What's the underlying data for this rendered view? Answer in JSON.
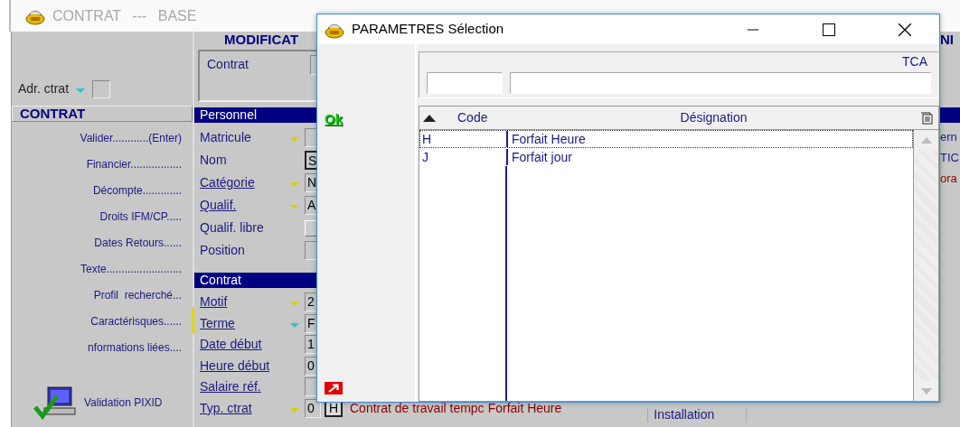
{
  "app_window": {
    "title": "CONTRAT --- BASE"
  },
  "sidebar": {
    "address": {
      "label": "Adr. ctrat",
      "color": "#20c8d0"
    },
    "header": "CONTRAT",
    "items": [
      "Valider............(Enter)",
      "Financier.................",
      "Décompte.............",
      "Droits IFM/CP.....",
      "Dates Retours......",
      "Texte.........................",
      "Profil  recherché...",
      "Caractérisques......",
      "nformations liées...."
    ],
    "pixid": "Validation PIXID"
  },
  "main": {
    "heading": "MODIFICAT",
    "contract_box_label": "Contrat",
    "sections": [
      {
        "title": "Personnel",
        "fields": [
          {
            "label": "Matricule",
            "underlined": false,
            "color": "#d8d000",
            "kind": "input"
          },
          {
            "label": "Nom",
            "underlined": false,
            "kind": "input",
            "value": "S",
            "bold_border": true
          },
          {
            "label": "Catégorie",
            "underlined": true,
            "color": "#d8d000",
            "kind": "input",
            "value": "N"
          },
          {
            "label": "Qualif.",
            "underlined": true,
            "color": "#d8d000",
            "kind": "input",
            "value": "A"
          },
          {
            "label": "Qualif. libre",
            "underlined": false,
            "kind": "button"
          },
          {
            "label": "Position",
            "underlined": false,
            "kind": "input"
          }
        ]
      },
      {
        "title": "Contrat",
        "fields": [
          {
            "label": "Motif",
            "underlined": true,
            "color": "#d8d000",
            "kind": "input",
            "value": "2"
          },
          {
            "label": "Terme",
            "underlined": true,
            "color": "#20c8d0",
            "kind": "input",
            "value": "F"
          },
          {
            "label": "Date début",
            "underlined": true,
            "kind": "input",
            "value": "1"
          },
          {
            "label": "Heure début",
            "underlined": true,
            "kind": "input",
            "value": "0"
          },
          {
            "label": "Salaire réf.",
            "underlined": true,
            "kind": "input"
          },
          {
            "label": "Typ. ctrat",
            "underlined": true,
            "color": "#d8d000",
            "kind": "input",
            "value": "0",
            "code": "H",
            "description": "Contrat de travail tempc",
            "designation": "Forfait Heure"
          }
        ]
      }
    ],
    "bottom_cell": "Installation"
  },
  "right_panel": {
    "heading": "NI",
    "texts": [
      "ern",
      "TIC",
      "ora"
    ]
  },
  "dialog": {
    "title": "PARAMETRES Sélection",
    "ok": "Ok",
    "filter_label": "TCA",
    "table": {
      "columns": [
        "Code",
        "Désignation"
      ],
      "rows": [
        {
          "code": "H",
          "designation": "Forfait Heure",
          "selected": true
        },
        {
          "code": "J",
          "designation": "Forfait jour",
          "selected": false
        }
      ]
    }
  }
}
